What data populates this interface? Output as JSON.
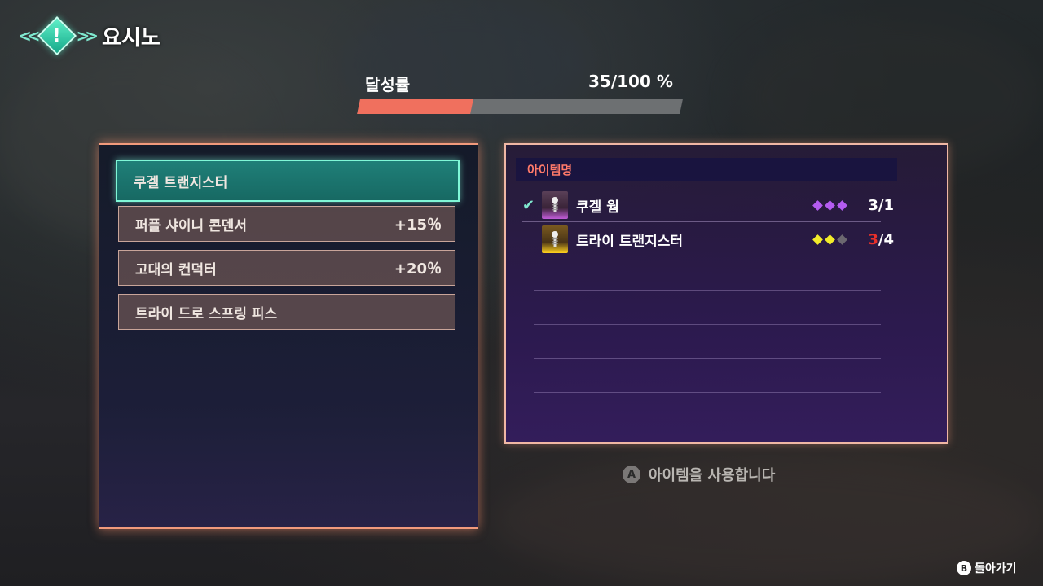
{
  "header": {
    "title": "요시노",
    "icon": "exclamation-diamond-icon"
  },
  "progress": {
    "label": "달성률",
    "value_text": "35/100 %",
    "percent": 35
  },
  "recipes": [
    {
      "name": "쿠겔 트랜지스터",
      "bonus": "",
      "selected": true
    },
    {
      "name": "퍼플 샤이니 콘덴서",
      "bonus": "+15％",
      "selected": false
    },
    {
      "name": "고대의 컨덕터",
      "bonus": "+20％",
      "selected": false
    },
    {
      "name": "트라이 드로 스프링 피스",
      "bonus": "",
      "selected": false
    }
  ],
  "materials": {
    "header": "아이템명",
    "items": [
      {
        "name": "쿠겔 웜",
        "owned": "3",
        "separator": "/",
        "required": "1",
        "rarity_filled": 3,
        "rarity_total": 3,
        "rarity_color": "#b45cf0",
        "checked": true,
        "icon_color": "purple"
      },
      {
        "name": "트라이 트랜지스터",
        "owned": "3",
        "separator": "/",
        "required": "4",
        "rarity_filled": 2,
        "rarity_total": 3,
        "rarity_color": "#f2ec2a",
        "checked": false,
        "icon_color": "yellow"
      }
    ]
  },
  "hint": {
    "button": "A",
    "text": "아이템을 사용합니다"
  },
  "back": {
    "button": "B",
    "text": "돌아가기"
  },
  "colors": {
    "accent": "#7fe8cf",
    "progress": "#f0705e",
    "insufficient": "#e8302a"
  }
}
